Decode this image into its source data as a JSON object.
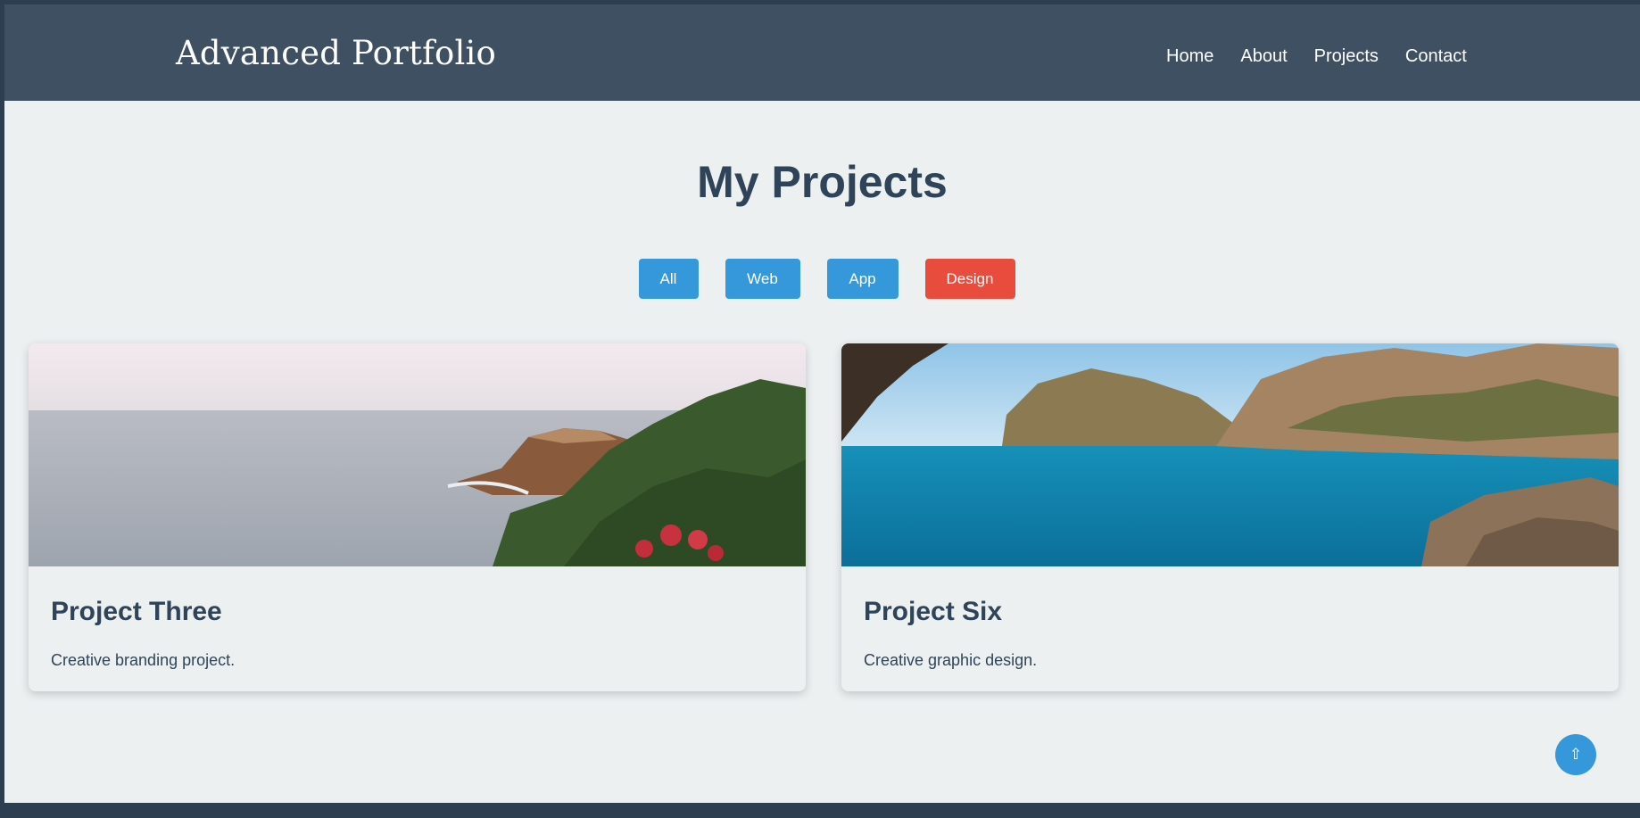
{
  "header": {
    "brand": "Advanced Portfolio",
    "nav": [
      "Home",
      "About",
      "Projects",
      "Contact"
    ]
  },
  "main": {
    "title": "My Projects",
    "filters": [
      "All",
      "Web",
      "App",
      "Design"
    ],
    "active_filter": "Design",
    "projects": [
      {
        "title": "Project Three",
        "description": "Creative branding project."
      },
      {
        "title": "Project Six",
        "description": "Creative graphic design."
      }
    ]
  },
  "scroll_top": {
    "icon": "arrow-up-icon",
    "glyph": "⇧"
  },
  "colors": {
    "header_bg": "#3e5061",
    "page_bg": "#ecf0f1",
    "accent": "#3498db",
    "active": "#e74c3c",
    "heading": "#2f4459"
  }
}
